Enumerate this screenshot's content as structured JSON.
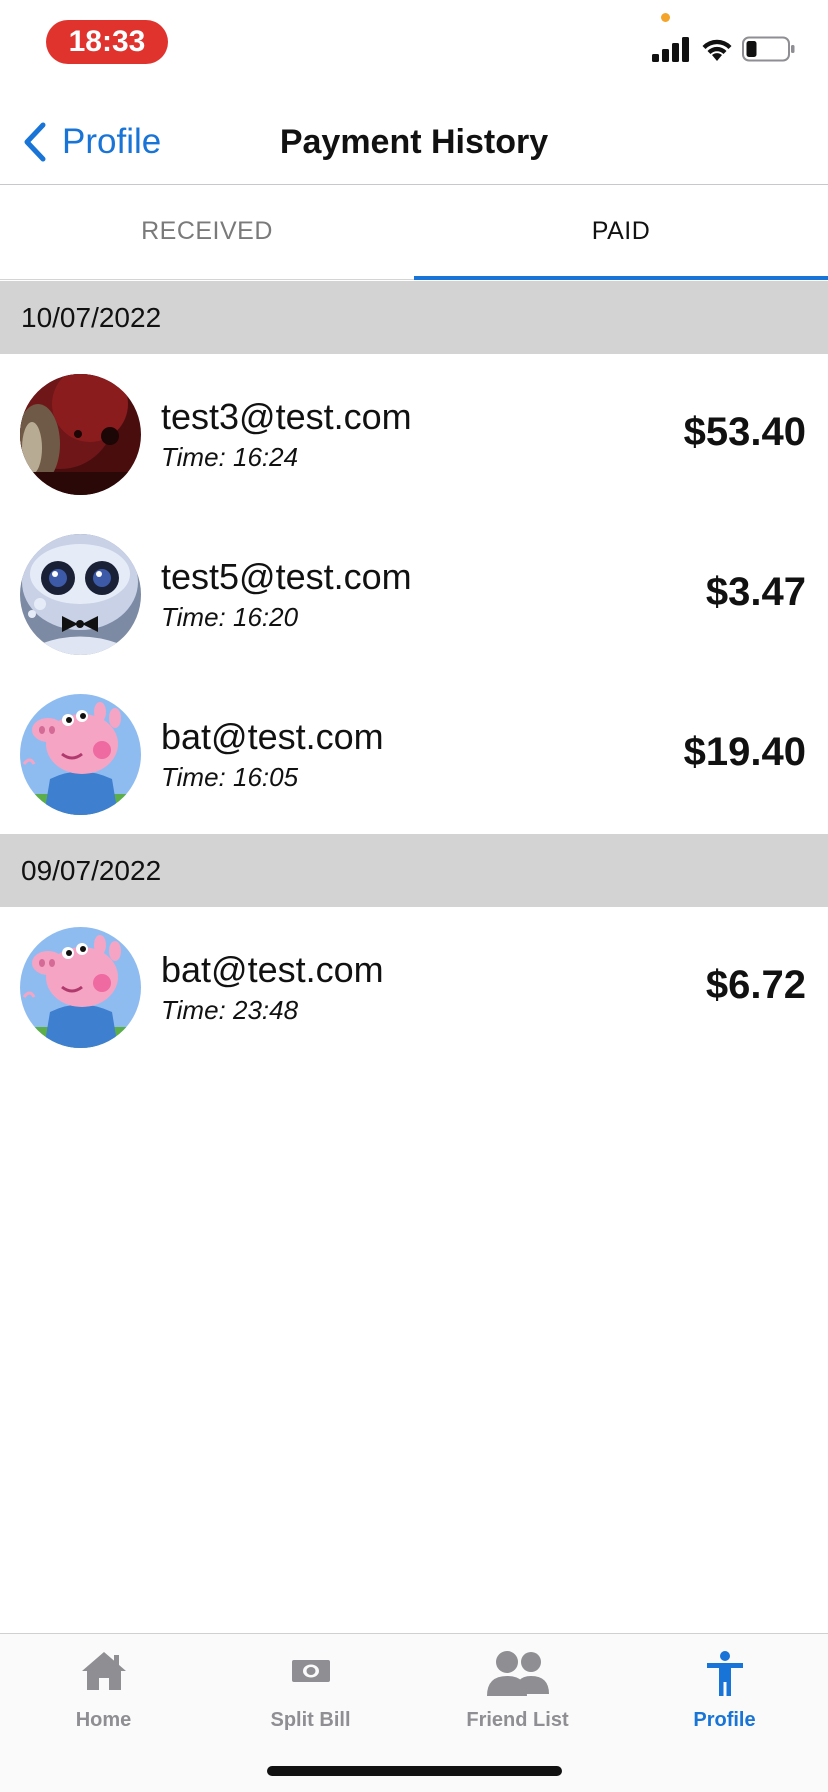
{
  "status_bar": {
    "time": "18:33",
    "icons": [
      "signal-icon",
      "wifi-icon",
      "battery-icon"
    ]
  },
  "nav": {
    "back_label": "Profile",
    "title": "Payment History"
  },
  "tabs": [
    {
      "label": "RECEIVED",
      "active": false
    },
    {
      "label": "PAID",
      "active": true
    }
  ],
  "sections": [
    {
      "date": "10/07/2022",
      "items": [
        {
          "email": "test3@test.com",
          "time": "Time: 16:24",
          "amount": "$53.40",
          "avatar": "red-photo-avatar"
        },
        {
          "email": "test5@test.com",
          "time": "Time: 16:20",
          "amount": "$3.47",
          "avatar": "robot-avatar"
        },
        {
          "email": "bat@test.com",
          "time": "Time: 16:05",
          "amount": "$19.40",
          "avatar": "pig-cartoon-avatar"
        }
      ]
    },
    {
      "date": "09/07/2022",
      "items": [
        {
          "email": "bat@test.com",
          "time": "Time: 23:48",
          "amount": "$6.72",
          "avatar": "pig-cartoon-avatar"
        }
      ]
    }
  ],
  "tab_bar": [
    {
      "label": "Home",
      "icon": "home-icon",
      "active": false
    },
    {
      "label": "Split Bill",
      "icon": "banknote-icon",
      "active": false
    },
    {
      "label": "Friend List",
      "icon": "people-icon",
      "active": false
    },
    {
      "label": "Profile",
      "icon": "person-icon",
      "active": true
    }
  ],
  "colors": {
    "accent": "#1874d6",
    "section_bg": "#d3d3d3",
    "time_pill": "#e0332d",
    "inactive": "#8e8e93"
  }
}
